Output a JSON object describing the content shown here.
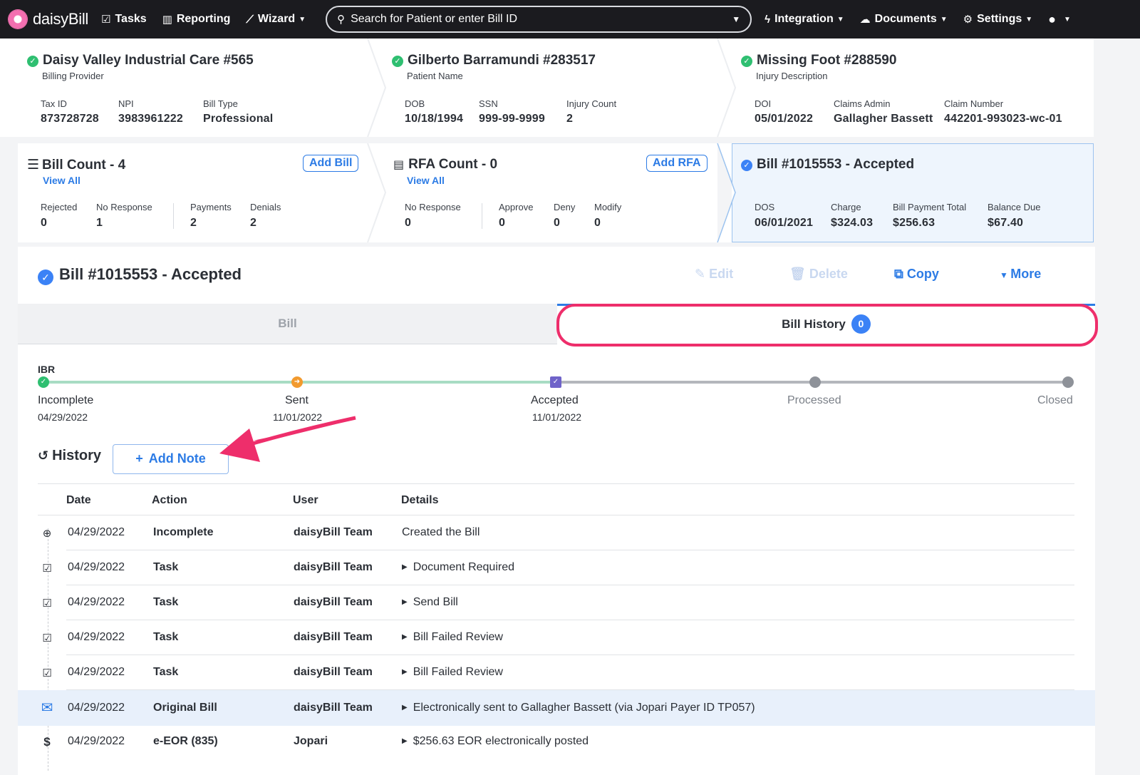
{
  "nav": {
    "brand": "daisyBill",
    "tasks": "Tasks",
    "reporting": "Reporting",
    "wizard": "Wizard",
    "search_placeholder": "Search for Patient or enter Bill ID",
    "integration": "Integration",
    "documents": "Documents",
    "settings": "Settings"
  },
  "provider": {
    "title": "Daisy Valley Industrial Care #565",
    "subtitle": "Billing Provider",
    "fields": [
      {
        "label": "Tax ID",
        "value": "873728728"
      },
      {
        "label": "NPI",
        "value": "3983961222"
      },
      {
        "label": "Bill Type",
        "value": "Professional"
      }
    ]
  },
  "patient": {
    "title": "Gilberto Barramundi #283517",
    "subtitle": "Patient Name",
    "fields": [
      {
        "label": "DOB",
        "value": "10/18/1994"
      },
      {
        "label": "SSN",
        "value": "999-99-9999"
      },
      {
        "label": "Injury Count",
        "value": "2"
      }
    ]
  },
  "injury": {
    "title": "Missing Foot #288590",
    "subtitle": "Injury Description",
    "fields": [
      {
        "label": "DOI",
        "value": "05/01/2022"
      },
      {
        "label": "Claims Admin",
        "value": "Gallagher Bassett"
      },
      {
        "label": "Claim Number",
        "value": "442201-993023-wc-01"
      }
    ]
  },
  "bills": {
    "title": "Bill Count - 4",
    "view_all": "View All",
    "add_button": "Add Bill",
    "fields": [
      {
        "label": "Rejected",
        "value": "0"
      },
      {
        "label": "No Response",
        "value": "1"
      },
      {
        "label": "Payments",
        "value": "2"
      },
      {
        "label": "Denials",
        "value": "2"
      }
    ]
  },
  "rfa": {
    "title": "RFA Count - 0",
    "view_all": "View All",
    "add_button": "Add RFA",
    "fields": [
      {
        "label": "No Response",
        "value": "0"
      },
      {
        "label": "Approve",
        "value": "0"
      },
      {
        "label": "Deny",
        "value": "0"
      },
      {
        "label": "Modify",
        "value": "0"
      }
    ]
  },
  "bill_summary": {
    "title": "Bill #1015553 - Accepted",
    "fields": [
      {
        "label": "DOS",
        "value": "06/01/2021"
      },
      {
        "label": "Charge",
        "value": "$324.03"
      },
      {
        "label": "Bill Payment Total",
        "value": "$256.63"
      },
      {
        "label": "Balance Due",
        "value": "$67.40"
      }
    ]
  },
  "main": {
    "title": "Bill #1015553 - Accepted",
    "actions": {
      "edit": "Edit",
      "delete": "Delete",
      "copy": "Copy",
      "more": "More"
    },
    "tabs": {
      "bill": "Bill",
      "history": "Bill History",
      "history_badge": "0"
    }
  },
  "progress": {
    "label": "IBR",
    "stages": [
      {
        "name": "Incomplete",
        "date": "04/29/2022"
      },
      {
        "name": "Sent",
        "date": "11/01/2022"
      },
      {
        "name": "Accepted",
        "date": "11/01/2022"
      },
      {
        "name": "Processed",
        "date": ""
      },
      {
        "name": "Closed",
        "date": ""
      }
    ],
    "colors": {
      "done": "#2fbf71",
      "sent": "#f29a2e",
      "accepted": "#6f63c9",
      "pending": "#8e9299",
      "done_track": "#a8dcc4",
      "pending_track": "#b4b7bc"
    }
  },
  "history": {
    "title": "History",
    "add_note": "Add Note",
    "headers": {
      "date": "Date",
      "action": "Action",
      "user": "User",
      "details": "Details"
    },
    "rows": [
      {
        "icon": "plus-circle-icon",
        "date": "04/29/2022",
        "action": "Incomplete",
        "user": "daisyBill Team",
        "details": "Created the Bill",
        "expandable": false
      },
      {
        "icon": "clipboard-check-icon",
        "date": "04/29/2022",
        "action": "Task",
        "user": "daisyBill Team",
        "details": "Document Required",
        "expandable": true
      },
      {
        "icon": "clipboard-check-icon",
        "date": "04/29/2022",
        "action": "Task",
        "user": "daisyBill Team",
        "details": "Send Bill",
        "expandable": true
      },
      {
        "icon": "clipboard-check-icon",
        "date": "04/29/2022",
        "action": "Task",
        "user": "daisyBill Team",
        "details": "Bill Failed Review",
        "expandable": true
      },
      {
        "icon": "clipboard-check-icon",
        "date": "04/29/2022",
        "action": "Task",
        "user": "daisyBill Team",
        "details": "Bill Failed Review",
        "expandable": true
      },
      {
        "icon": "envelope-icon",
        "date": "04/29/2022",
        "action": "Original Bill",
        "user": "daisyBill Team",
        "details": "Electronically sent to Gallagher Bassett (via Jopari Payer ID TP057)",
        "expandable": true
      },
      {
        "icon": "dollar-icon",
        "date": "04/29/2022",
        "action": "e-EOR (835)",
        "user": "Jopari",
        "details": "$256.63 EOR electronically posted",
        "expandable": true
      }
    ]
  },
  "colors": {
    "accent": "#2c7be5",
    "highlight": "#ee2e6b",
    "nav_bg": "#1b1b1f"
  }
}
